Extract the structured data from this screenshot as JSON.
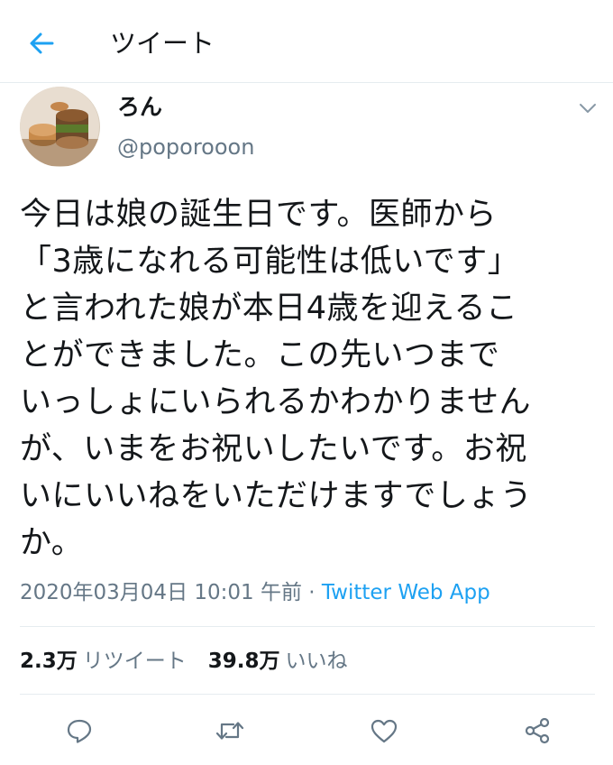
{
  "header": {
    "title": "ツイート",
    "accent_color": "#1da1f2"
  },
  "tweet": {
    "author": {
      "name": "ろん",
      "handle": "@poporooon"
    },
    "text": "今日は娘の誕生日です。医師から\n「3歳になれる可能性は低いです」\nと言われた娘が本日4歳を迎えるこ\nとができました。この先いつまで\nいっしょにいられるかわかりません\nが、いまをお祝いしたいです。お祝\nいにいいねをいただけますでしょう\nか。",
    "timestamp": "2020年03月04日 10:01 午前",
    "separator": " · ",
    "client": "Twitter Web App",
    "stats": {
      "retweets_count": "2.3万",
      "retweets_label": "リツイート",
      "likes_count": "39.8万",
      "likes_label": "いいね"
    }
  },
  "icons": {
    "back": "arrow-left-icon",
    "caret": "chevron-down-icon",
    "reply": "reply-icon",
    "retweet": "retweet-icon",
    "like": "heart-icon",
    "share": "share-icon"
  },
  "colors": {
    "text_primary": "#14171a",
    "text_secondary": "#657786",
    "divider": "#e6ecf0",
    "link": "#1da1f2"
  }
}
